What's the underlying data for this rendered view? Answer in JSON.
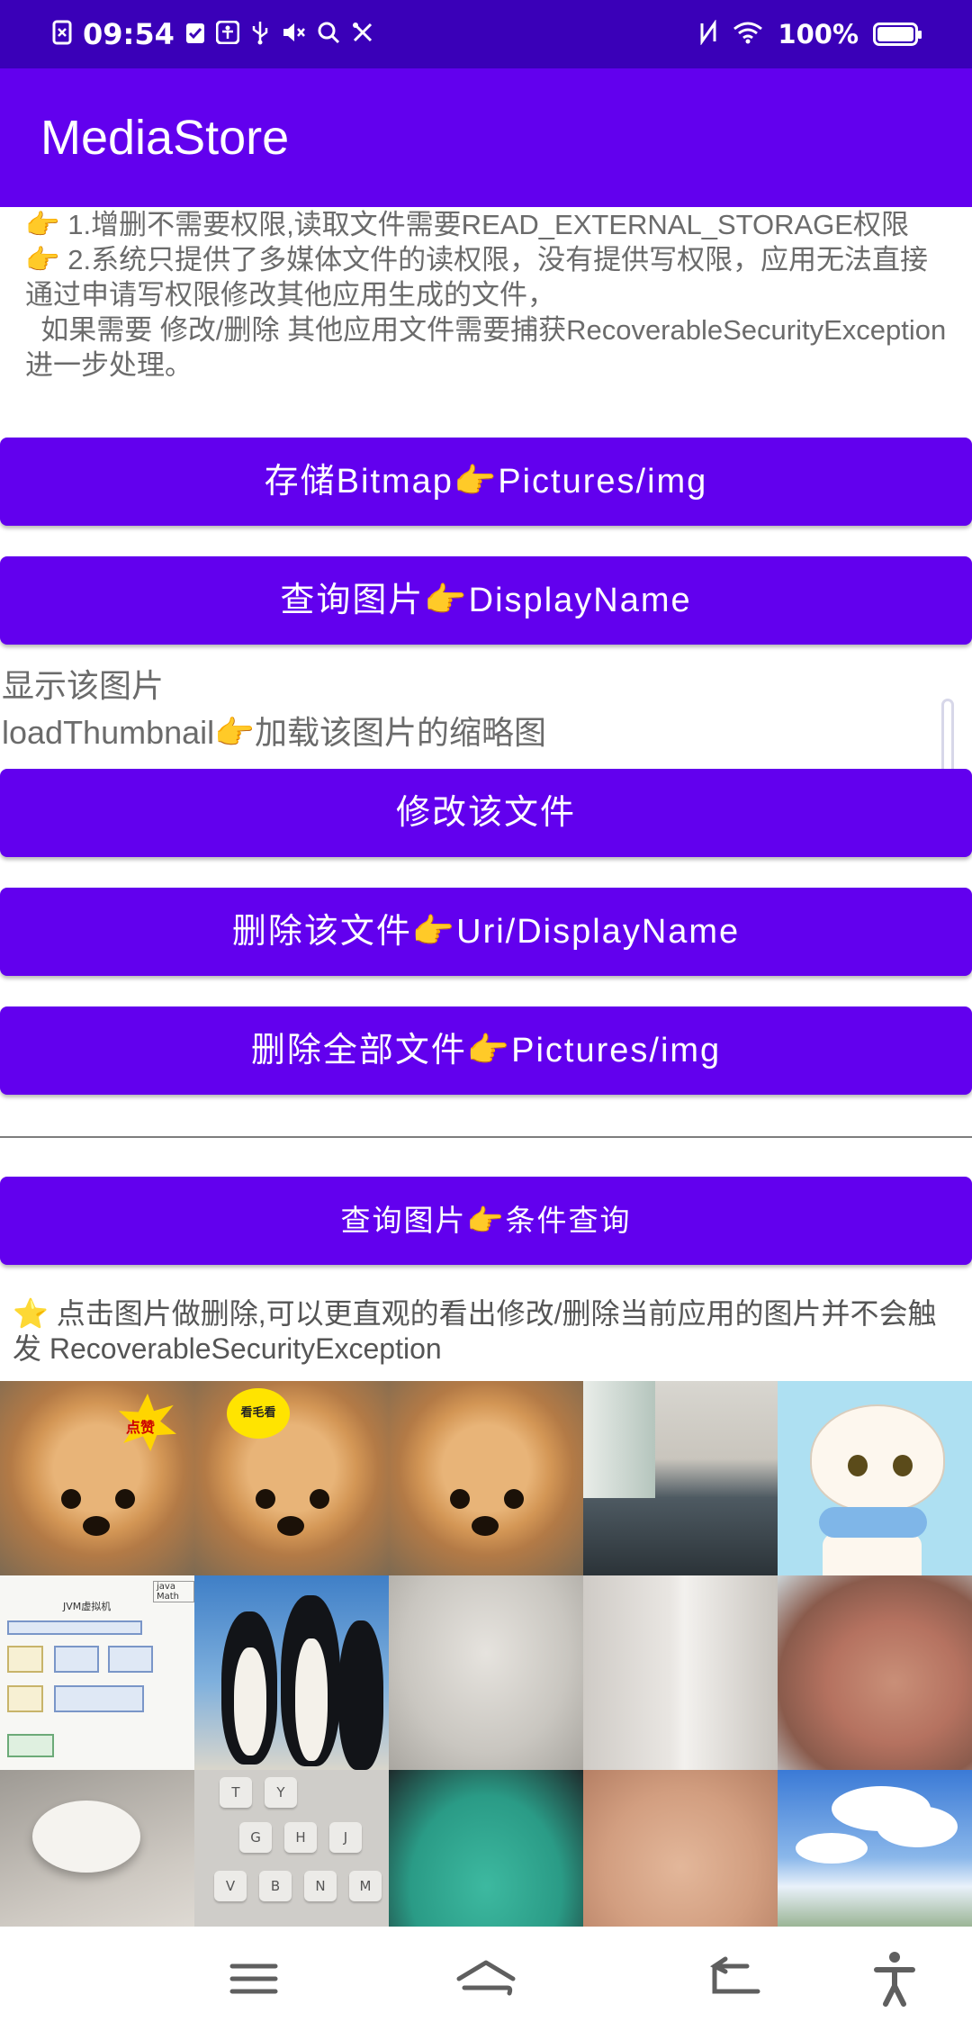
{
  "status_bar": {
    "time": "09:54",
    "battery": "100%",
    "left_icons": [
      "screenshot-icon",
      "check-icon",
      "accessibility-icon",
      "usb-icon",
      "mute-icon",
      "search-icon",
      "tools-icon"
    ],
    "right_icons": [
      "nfc-icon",
      "wifi-icon",
      "battery-icon"
    ]
  },
  "app_bar": {
    "title": "MediaStore"
  },
  "description": {
    "line1": "👉 1.增删不需要权限,读取文件需要READ_EXTERNAL_STORAGE权限",
    "line2": "👉 2.系统只提供了多媒体文件的读权限，没有提供写权限，应用无法直接通过申请写权限修改其他应用生成的文件，",
    "line3": "  如果需要 修改/删除 其他应用文件需要捕获RecoverableSecurityException 进一步处理。"
  },
  "buttons": {
    "save_bitmap": "存储Bitmap👉Pictures/img",
    "query_display_name": "查询图片👉DisplayName",
    "modify_file": "修改该文件",
    "delete_file": "删除该文件👉Uri/DisplayName",
    "delete_all": "删除全部文件👉Pictures/img",
    "query_condition": "查询图片👉条件查询"
  },
  "labels": {
    "show_image": "显示该图片",
    "load_thumbnail": "loadThumbnail👉加载该图片的缩略图"
  },
  "hint": "⭐ 点击图片做删除,可以更直观的看出修改/删除当前应用的图片并不会触发 RecoverableSecurityException",
  "grid": {
    "columns": 5,
    "thumbnails": [
      "puppy-star",
      "puppy-bubble",
      "puppy",
      "office",
      "cat-sticker",
      "diagram",
      "penguins",
      "blur-gray",
      "blur-light",
      "finger",
      "mouse",
      "keyboard",
      "green-cloth",
      "hand",
      "sky"
    ],
    "sticker_text_1": "点赞",
    "sticker_text_2": "看毛看",
    "diagram_title": "JVM虚拟机",
    "diagram_tag": "java Math",
    "keyboard_keys": [
      "T",
      "Y",
      "G",
      "H",
      "J",
      "V",
      "B",
      "N",
      "M"
    ]
  },
  "nav_bar": {
    "icons": [
      "menu-icon",
      "home-icon",
      "back-icon",
      "accessibility-icon"
    ]
  },
  "colors": {
    "status_bar": "#3a00b8",
    "primary": "#6200ee",
    "text_gray": "#6b6b6b"
  }
}
